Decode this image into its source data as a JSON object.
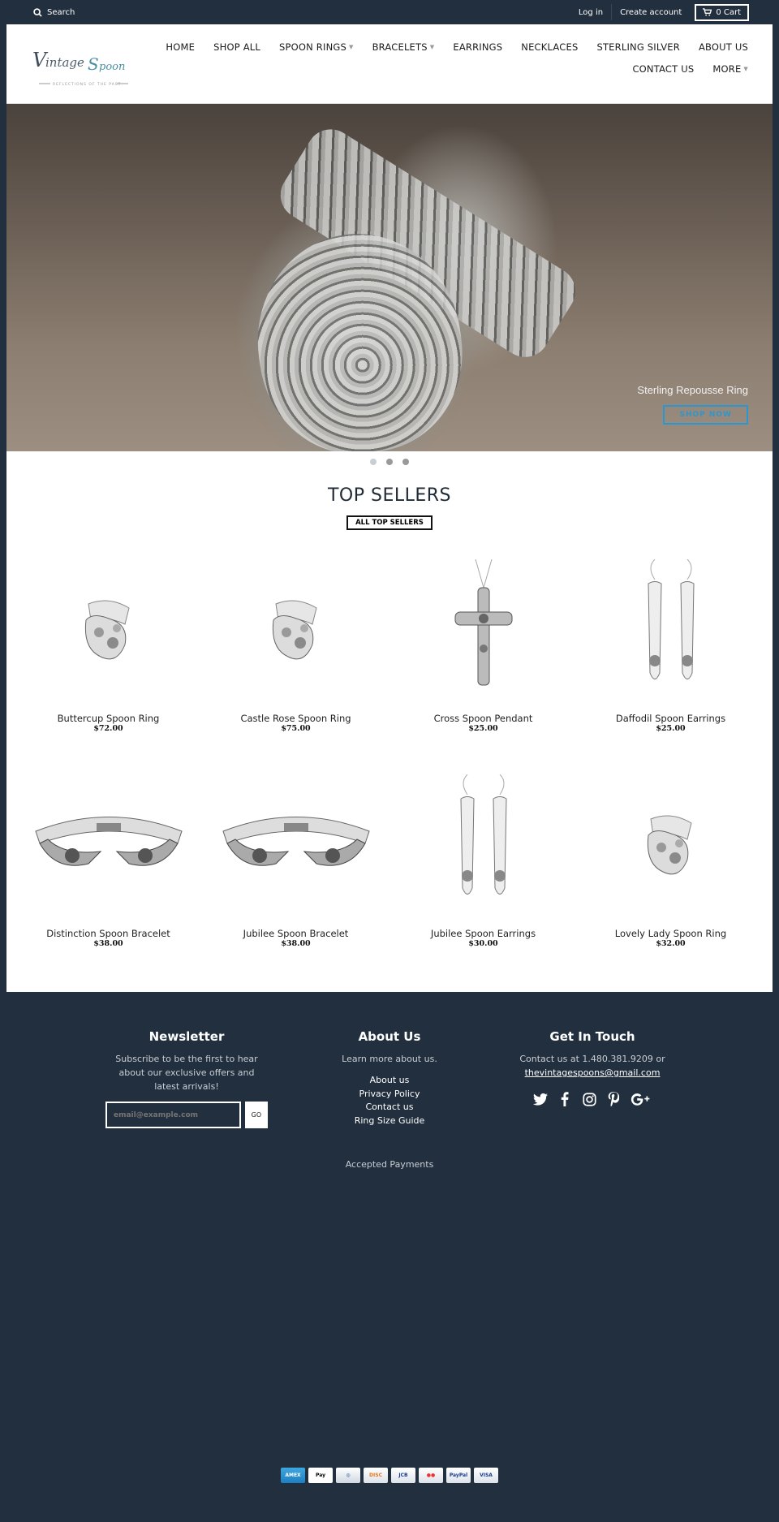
{
  "topbar": {
    "search_label": "Search",
    "login": "Log in",
    "create_account": "Create account",
    "cart": "0 Cart"
  },
  "logo": {
    "brand_text": "VintageSpoon",
    "tagline": "REFLECTIONS OF THE PAST"
  },
  "nav": [
    {
      "label": "HOME",
      "dropdown": false
    },
    {
      "label": "SHOP ALL",
      "dropdown": false
    },
    {
      "label": "SPOON RINGS",
      "dropdown": true
    },
    {
      "label": "BRACELETS",
      "dropdown": true
    },
    {
      "label": "EARRINGS",
      "dropdown": false
    },
    {
      "label": "NECKLACES",
      "dropdown": false
    },
    {
      "label": "STERLING SILVER",
      "dropdown": false
    },
    {
      "label": "ABOUT US",
      "dropdown": false
    },
    {
      "label": "CONTACT US",
      "dropdown": false
    },
    {
      "label": "MORE",
      "dropdown": true
    }
  ],
  "hero": {
    "caption": "Sterling Repousse Ring",
    "button": "SHOP NOW",
    "slides": 3,
    "active_slide": 1,
    "accent": "#2a98d0"
  },
  "top_sellers": {
    "title": "TOP SELLERS",
    "button": "ALL TOP SELLERS",
    "products": [
      {
        "name": "Buttercup Spoon Ring",
        "price": "$72.00",
        "type": "ring"
      },
      {
        "name": "Castle Rose Spoon Ring",
        "price": "$75.00",
        "type": "ring"
      },
      {
        "name": "Cross Spoon Pendant",
        "price": "$25.00",
        "type": "pendant"
      },
      {
        "name": "Daffodil Spoon Earrings",
        "price": "$25.00",
        "type": "earrings"
      },
      {
        "name": "Distinction Spoon Bracelet",
        "price": "$38.00",
        "type": "bracelet"
      },
      {
        "name": "Jubilee Spoon Bracelet",
        "price": "$38.00",
        "type": "bracelet"
      },
      {
        "name": "Jubilee Spoon Earrings",
        "price": "$30.00",
        "type": "earrings"
      },
      {
        "name": "Lovely Lady Spoon Ring",
        "price": "$32.00",
        "type": "ring"
      }
    ]
  },
  "footer": {
    "newsletter": {
      "title": "Newsletter",
      "text": "Subscribe to be the first to hear about our exclusive offers and latest arrivals!",
      "placeholder": "email@example.com",
      "button": "GO"
    },
    "about": {
      "title": "About Us",
      "text": "Learn more about us.",
      "links": [
        "About us",
        "Privacy Policy",
        "Contact us",
        "Ring Size Guide"
      ]
    },
    "contact": {
      "title": "Get In Touch",
      "text": "Contact us at 1.480.381.9209 or",
      "email": "thevintagespoons@gmail.com",
      "social": [
        "twitter",
        "facebook",
        "instagram",
        "pinterest",
        "google-plus"
      ]
    },
    "accepted_payments": "Accepted Payments",
    "payment_methods": [
      "American Express",
      "Apple Pay",
      "Diners Club",
      "Discover",
      "JCB",
      "Mastercard",
      "PayPal",
      "Visa"
    ],
    "background": "#222f3e"
  }
}
